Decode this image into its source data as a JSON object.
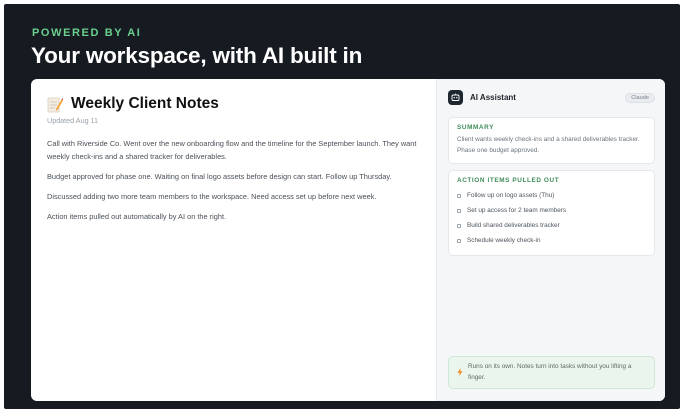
{
  "hero": {
    "eyebrow": "POWERED BY AI",
    "headline": "Your workspace, with AI built in"
  },
  "note": {
    "title": "Weekly Client Notes",
    "updated": "Updated Aug 11",
    "icon": "memo-icon",
    "paragraphs": [
      "Call with Riverside Co. Went over the new onboarding flow and the timeline for the September launch. They want weekly check-ins and a shared tracker for deliverables.",
      "Budget approved for phase one. Waiting on final logo assets before design can start. Follow up Thursday.",
      "Discussed adding two more team members to the workspace. Need access set up before next week.",
      "Action items pulled out automatically by AI on the right."
    ]
  },
  "assistant": {
    "title": "AI Assistant",
    "badge": "Claude",
    "logo_icon": "ai-logo-icon",
    "summary_label": "SUMMARY",
    "summary_text": "Client wants weekly check-ins and a shared deliverables tracker. Phase one budget approved.",
    "actions_label": "ACTION ITEMS PULLED OUT",
    "actions": [
      "Follow up on logo assets (Thu)",
      "Set up access for 2 team members",
      "Build shared deliverables tracker",
      "Schedule weekly check-in"
    ],
    "footer_icon": "bolt-icon",
    "footer_text": "Runs on its own. Notes turn into tasks without you lifting a finger."
  },
  "colors": {
    "background": "#161b22",
    "accent_green": "#69d08d",
    "label_green": "#3f8c5b",
    "panel": "#f4f6f8"
  }
}
